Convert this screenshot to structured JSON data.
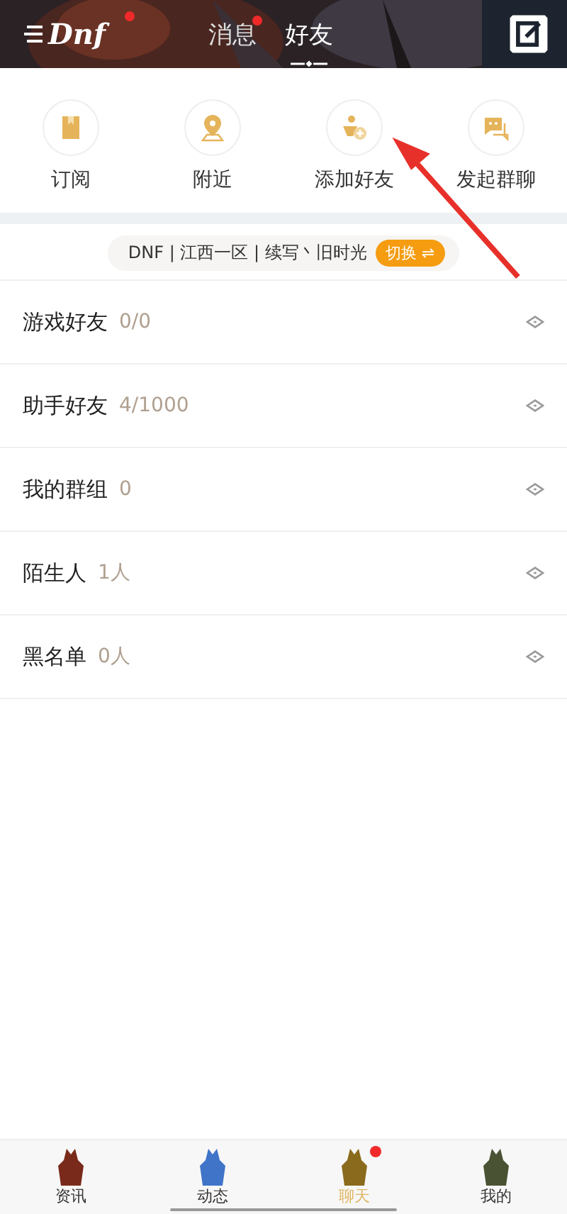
{
  "header": {
    "logo": "Dnf",
    "logo_badge": true,
    "tabs": [
      {
        "label": "消息",
        "selected": false,
        "badge": true
      },
      {
        "label": "好友",
        "selected": true,
        "badge": false
      }
    ]
  },
  "actions": [
    {
      "label": "订阅",
      "kind": "book"
    },
    {
      "label": "附近",
      "kind": "pin"
    },
    {
      "label": "添加好友",
      "kind": "add-friend"
    },
    {
      "label": "发起群聊",
      "kind": "chat"
    }
  ],
  "server": {
    "text": "DNF | 江西一区 | 续写丶旧时光",
    "switch": "切换 ⇌"
  },
  "groups": [
    {
      "name": "游戏好友",
      "count": "0/0"
    },
    {
      "name": "助手好友",
      "count": "4/1000"
    },
    {
      "name": "我的群组",
      "count": "0"
    },
    {
      "name": "陌生人",
      "count": "1人"
    },
    {
      "name": "黑名单",
      "count": "0人"
    }
  ],
  "nav": [
    {
      "label": "资讯",
      "selected": false,
      "badge": false,
      "color": "#7a2a1a"
    },
    {
      "label": "动态",
      "selected": false,
      "badge": false,
      "color": "#3f74c8"
    },
    {
      "label": "聊天",
      "selected": true,
      "badge": true,
      "color": "#8a6a1c"
    },
    {
      "label": "我的",
      "selected": false,
      "badge": false,
      "color": "#4a5234"
    }
  ]
}
